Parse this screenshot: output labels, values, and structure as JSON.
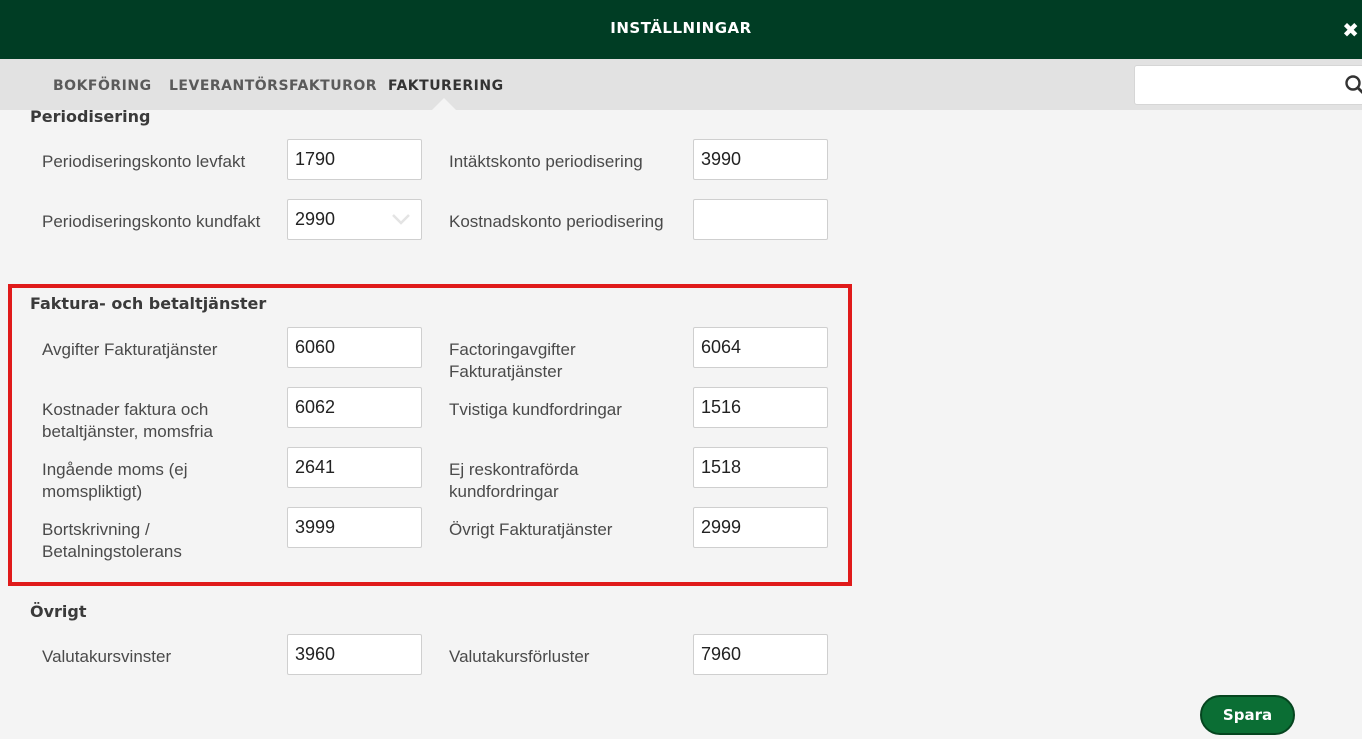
{
  "header": {
    "title": "INSTÄLLNINGAR",
    "close_glyph": "✖"
  },
  "tabs": [
    {
      "label": "BOKFÖRING"
    },
    {
      "label": "LEVERANTÖRSFAKTUROR"
    },
    {
      "label": "FAKTURERING"
    }
  ],
  "search": {
    "value": "",
    "placeholder": ""
  },
  "sections": {
    "periodisering": {
      "title": "Periodisering",
      "fields": [
        {
          "label": "Periodiseringskonto levfakt",
          "value": "1790"
        },
        {
          "label": "Intäktskonto periodisering",
          "value": "3990"
        },
        {
          "label": "Periodiseringskonto kundfakt",
          "value": "2990"
        },
        {
          "label": "Kostnadskonto periodisering",
          "value": ""
        }
      ]
    },
    "faktura": {
      "title": "Faktura- och betaltjänster",
      "fields": [
        {
          "label": "Avgifter Fakturatjänster",
          "value": "6060"
        },
        {
          "label": "Factoringavgifter Fakturatjänster",
          "value": "6064"
        },
        {
          "label": "Kostnader faktura och betaltjänster, momsfria",
          "value": "6062"
        },
        {
          "label": "Tvistiga kundfordringar",
          "value": "1516"
        },
        {
          "label": "Ingående moms (ej momspliktigt)",
          "value": "2641"
        },
        {
          "label": "Ej reskontraförda kundfordringar",
          "value": "1518"
        },
        {
          "label": "Bortskrivning / Betalningstolerans",
          "value": "3999"
        },
        {
          "label": "Övrigt Fakturatjänster",
          "value": "2999"
        }
      ]
    },
    "ovrigt": {
      "title": "Övrigt",
      "fields": [
        {
          "label": "Valutakursvinster",
          "value": "3960"
        },
        {
          "label": "Valutakursförluster",
          "value": "7960"
        }
      ]
    }
  },
  "save_label": "Spara",
  "colors": {
    "header_bg": "#003d24",
    "tab_bg": "#e2e2e2",
    "save_bg": "#0b6e34",
    "highlight": "#e01a1a"
  }
}
